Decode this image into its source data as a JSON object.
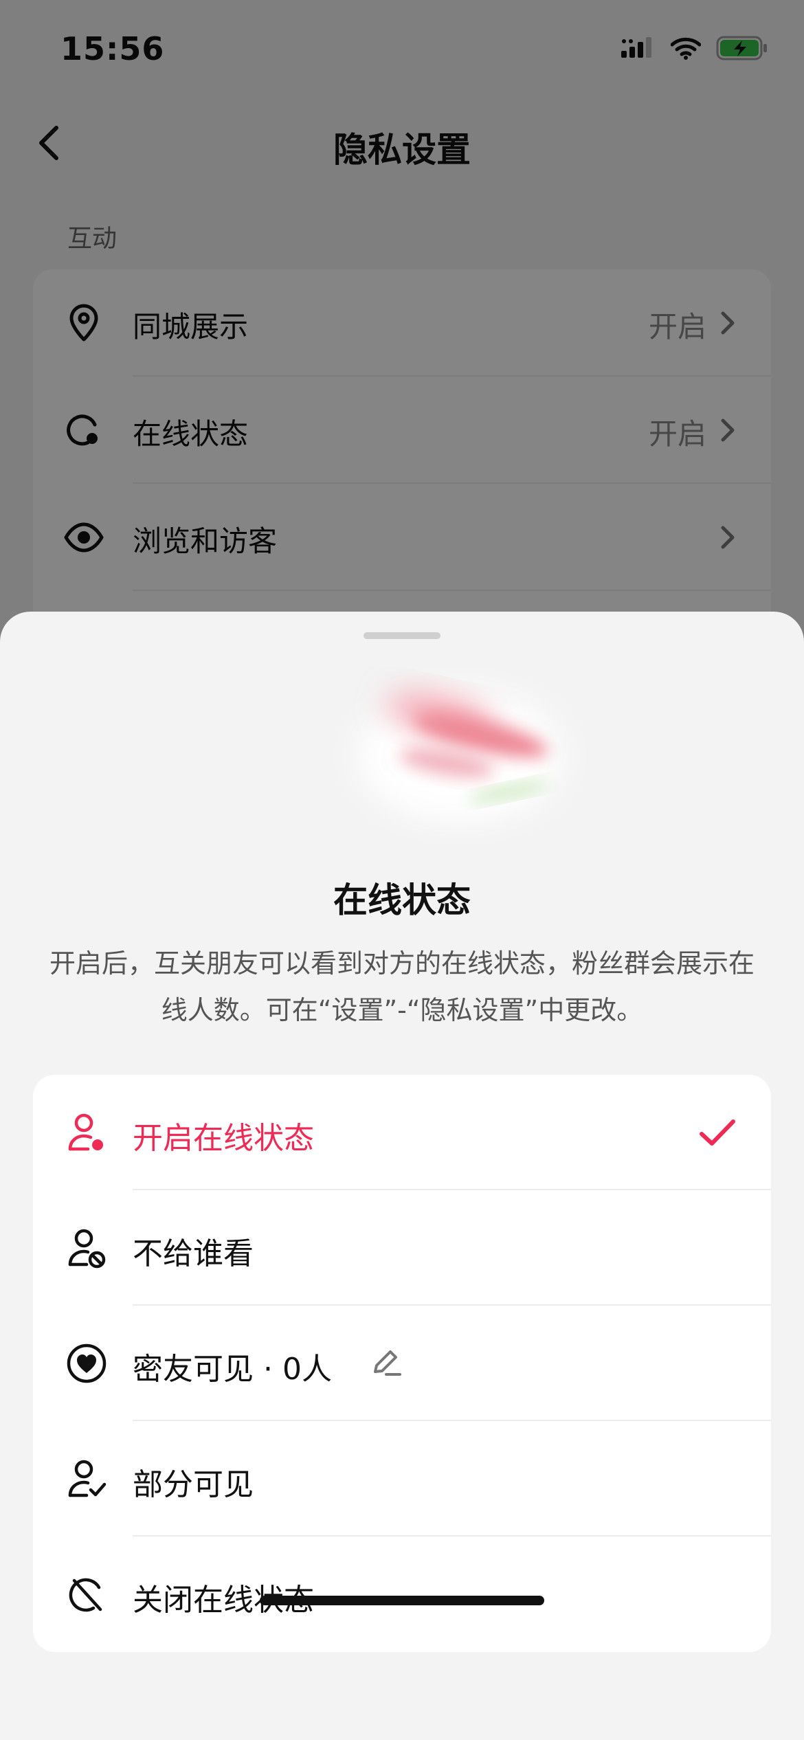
{
  "status_bar": {
    "time": "15:56",
    "icons": [
      "signal-icon",
      "wifi-icon",
      "battery-charging-icon"
    ]
  },
  "nav": {
    "title": "隐私设置",
    "back_icon": "chevron-left-icon"
  },
  "section": {
    "label": "互动"
  },
  "background_rows": [
    {
      "icon": "location-pin-icon",
      "label": "同城展示",
      "value": "开启"
    },
    {
      "icon": "online-status-icon",
      "label": "在线状态",
      "value": "开启"
    },
    {
      "icon": "eye-icon",
      "label": "浏览和访客",
      "value": ""
    }
  ],
  "sheet": {
    "title": "在线状态",
    "description": "开启后，互关朋友可以看到对方的在线状态，粉丝群会展示在线人数。可在“设置”-“隐私设置”中更改。",
    "options": [
      {
        "icon": "user-online-icon",
        "label": "开启在线状态",
        "selected": true
      },
      {
        "icon": "user-block-icon",
        "label": "不给谁看",
        "selected": false
      },
      {
        "icon": "heart-circle-icon",
        "label": "密友可见 · 0人",
        "selected": false,
        "edit_icon": "pencil-icon"
      },
      {
        "icon": "user-check-icon",
        "label": "部分可见",
        "selected": false
      },
      {
        "icon": "online-off-icon",
        "label": "关闭在线状态",
        "selected": false
      }
    ]
  },
  "colors": {
    "accent": "#ee2a55",
    "text": "#111111",
    "secondary": "#555555"
  }
}
